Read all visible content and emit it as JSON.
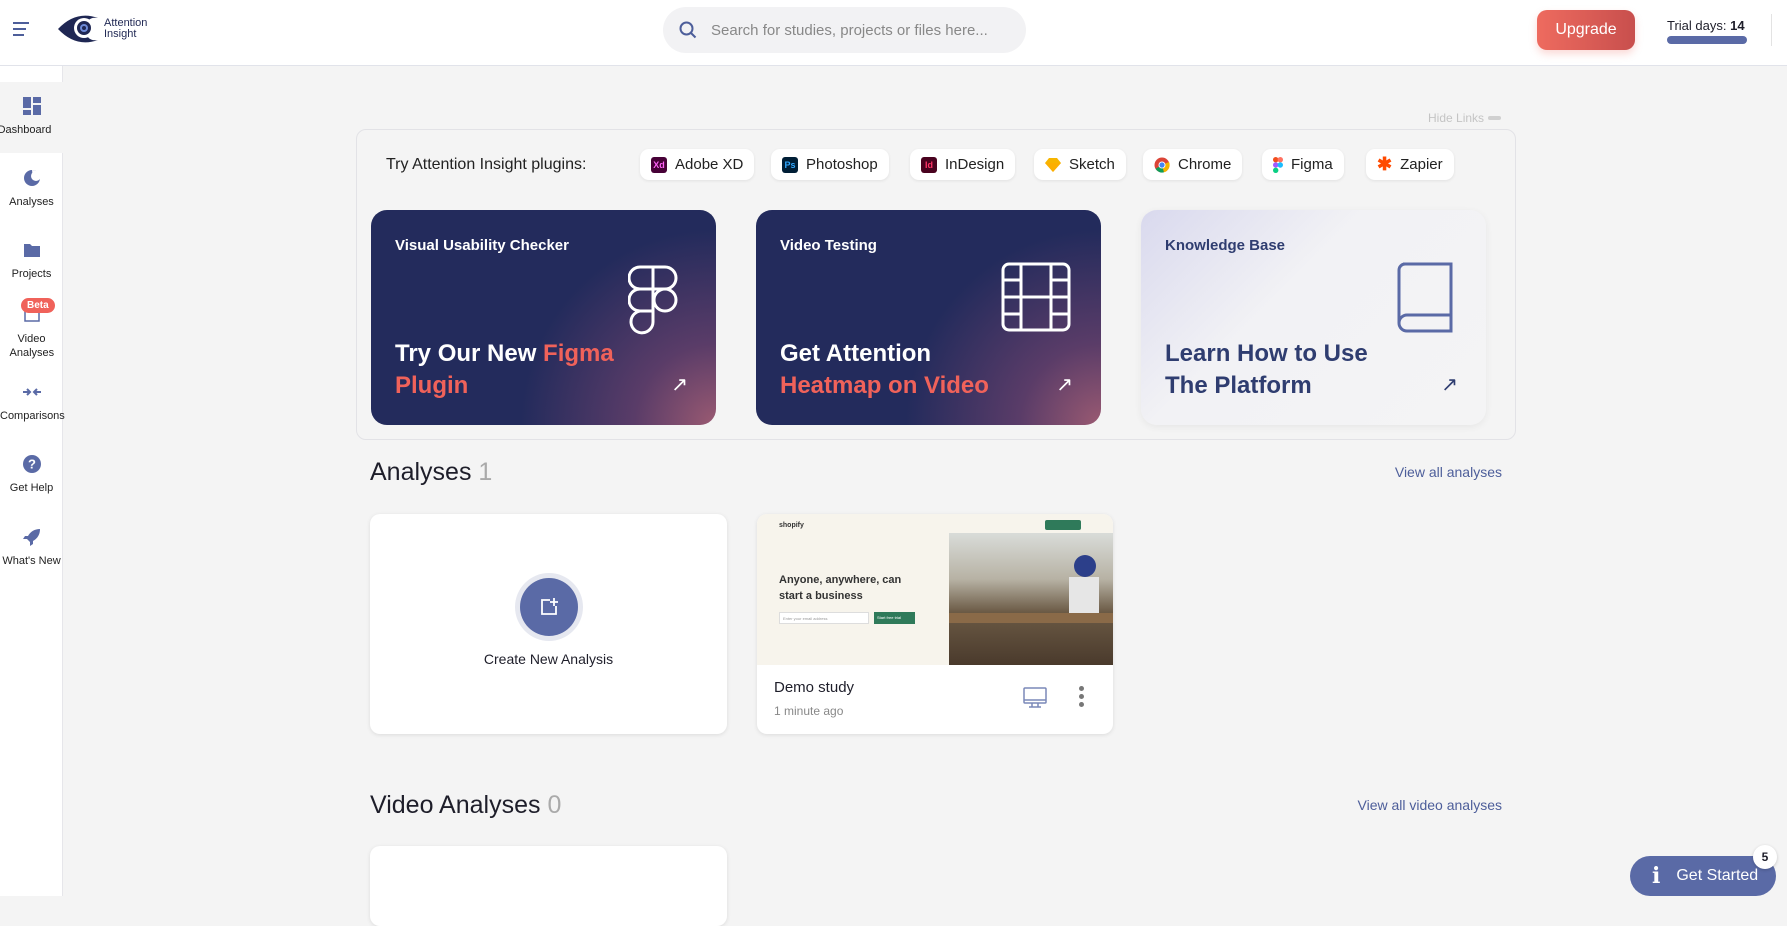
{
  "header": {
    "logo_text_line1": "Attention",
    "logo_text_line2": "Insight",
    "search_placeholder": "Search for studies, projects or files here...",
    "upgrade_label": "Upgrade",
    "trial_label": "Trial days:",
    "trial_days": "14",
    "trial_progress": 1.0
  },
  "sidebar": {
    "items": [
      {
        "label": "Dashboard",
        "icon": "dashboard-icon"
      },
      {
        "label": "Analyses",
        "icon": "pie-chart-icon"
      },
      {
        "label": "Projects",
        "icon": "folder-icon"
      },
      {
        "label": "Video Analyses",
        "icon": "clapperboard-icon",
        "badge": "Beta"
      },
      {
        "label": "Comparisons",
        "icon": "compare-arrows-icon"
      },
      {
        "label": "Get Help",
        "icon": "help-icon"
      },
      {
        "label": "What's New",
        "icon": "rocket-icon"
      }
    ]
  },
  "links": {
    "hide_label": "Hide Links",
    "plugins_label": "Try Attention Insight plugins:",
    "plugins": [
      {
        "label": "Adobe XD",
        "icon": "adobe-xd-icon",
        "abbr": "Xd"
      },
      {
        "label": "Photoshop",
        "icon": "photoshop-icon",
        "abbr": "Ps"
      },
      {
        "label": "InDesign",
        "icon": "indesign-icon",
        "abbr": "Id"
      },
      {
        "label": "Sketch",
        "icon": "sketch-icon"
      },
      {
        "label": "Chrome",
        "icon": "chrome-icon"
      },
      {
        "label": "Figma",
        "icon": "figma-icon"
      },
      {
        "label": "Zapier",
        "icon": "zapier-icon"
      }
    ],
    "cards": [
      {
        "small": "Visual Usability Checker",
        "big_a": "Try Our New ",
        "big_b": "Figma",
        "big_c": "Plugin"
      },
      {
        "small": "Video Testing",
        "big_a": "Get Attention",
        "big_b": "Heatmap on Video"
      },
      {
        "small": "Knowledge Base",
        "big_a": "Learn How to Use",
        "big_b": "The Platform"
      }
    ]
  },
  "analyses": {
    "title": "Analyses",
    "count": "1",
    "view_all": "View all analyses",
    "create_label": "Create New Analysis",
    "items": [
      {
        "name": "Demo study",
        "time": "1 minute ago",
        "device": "desktop-icon",
        "thumb": {
          "brand": "shopify",
          "headline_1": "Anyone, anywhere, can",
          "headline_2": "start a business",
          "cta": "Start free trial",
          "email_placeholder": "Enter your email address"
        }
      }
    ]
  },
  "video_analyses": {
    "title": "Video Analyses",
    "count": "0",
    "view_all": "View all video analyses"
  },
  "get_started": {
    "label": "Get Started",
    "badge": "5"
  },
  "colors": {
    "accent": "#5a6aa6",
    "brand_red": "#f0625a",
    "navy": "#232b5c"
  }
}
